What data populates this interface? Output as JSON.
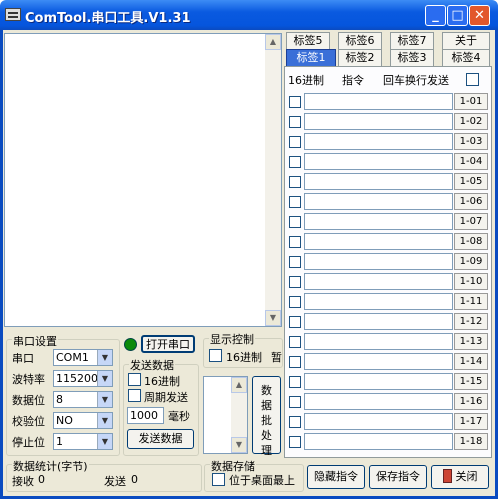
{
  "window": {
    "title": "ComTool.串口工具.V1.31"
  },
  "serial": {
    "group_label": "串口设置",
    "port_label": "串口",
    "port_value": "COM1",
    "baud_label": "波特率",
    "baud_value": "115200",
    "data_label": "数据位",
    "data_value": "8",
    "parity_label": "校验位",
    "parity_value": "NO",
    "stop_label": "停止位",
    "stop_value": "1"
  },
  "open_button": "打开串口",
  "send": {
    "group_label": "发送数据",
    "hex_label": "16进制",
    "periodic_label": "周期发送",
    "period_value": "1000",
    "period_unit": "毫秒",
    "send_button": "发送数据"
  },
  "display": {
    "group_label": "显示控制",
    "hex_label": "16进制",
    "pause_label": "暂"
  },
  "batch_button": [
    "数",
    "据",
    "批",
    "处",
    "理"
  ],
  "stats": {
    "group_label": "数据统计(字节)",
    "recv_label": "接收",
    "recv_value": "0",
    "send_label": "发送",
    "send_value": "0"
  },
  "storage": {
    "group_label": "数据存储",
    "desktop_label": "位于桌面最上"
  },
  "bottom_buttons": {
    "hide": "隐藏指令",
    "save": "保存指令",
    "close": "关闭"
  },
  "tabs": {
    "row1": [
      "标签5",
      "标签6",
      "标签7",
      "关于"
    ],
    "row2": [
      "标签1",
      "标签2",
      "标签3",
      "标签4"
    ]
  },
  "cmd_header": {
    "hex": "16进制",
    "cmd": "指令",
    "crlf": "回车换行发送"
  },
  "commands": [
    "1-01",
    "1-02",
    "1-03",
    "1-04",
    "1-05",
    "1-06",
    "1-07",
    "1-08",
    "1-09",
    "1-10",
    "1-11",
    "1-12",
    "1-13",
    "1-14",
    "1-15",
    "1-16",
    "1-17",
    "1-18"
  ]
}
